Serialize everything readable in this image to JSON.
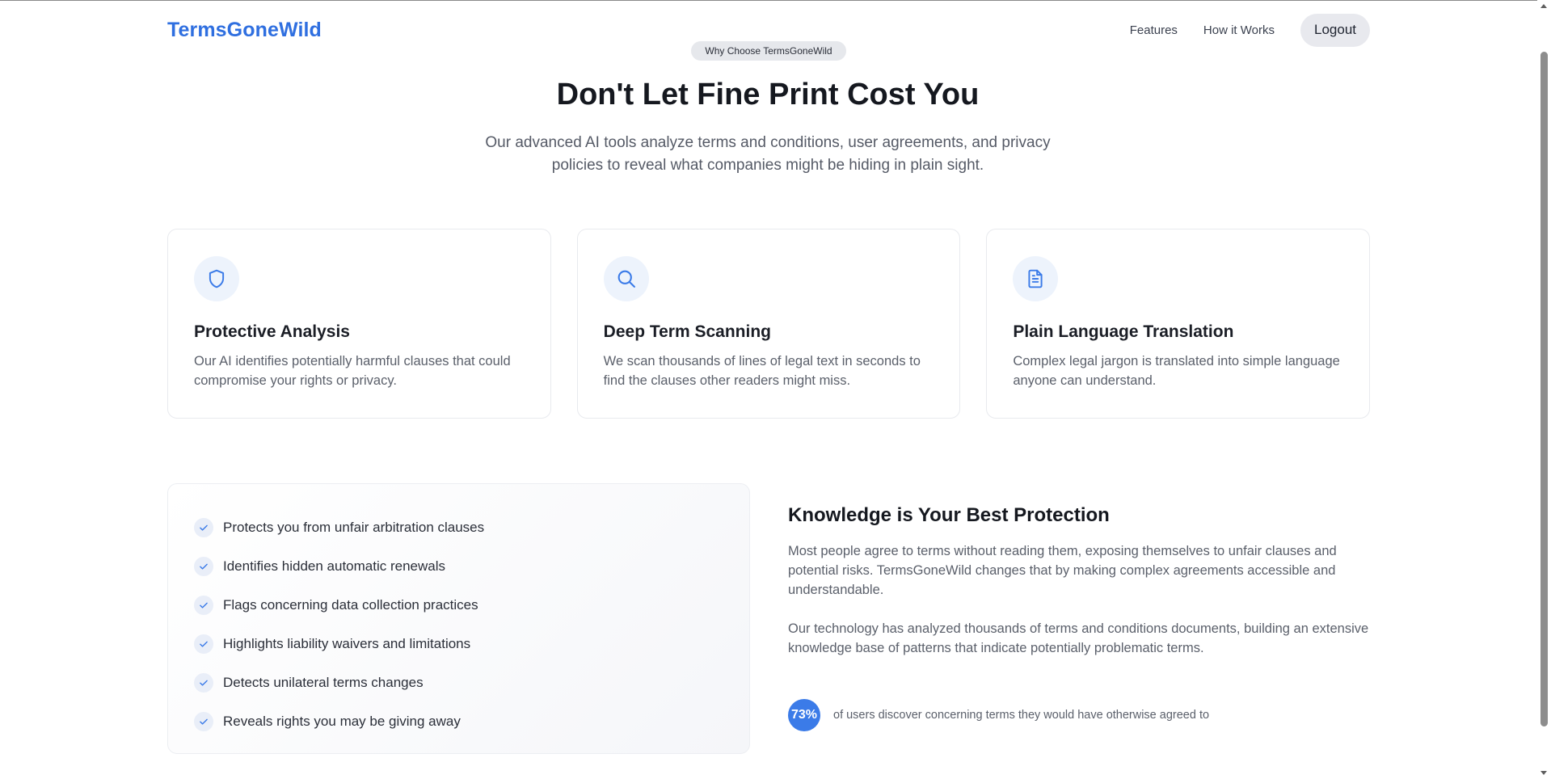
{
  "header": {
    "logo": "TermsGoneWild",
    "nav": [
      "Features",
      "How it Works"
    ],
    "logout_label": "Logout"
  },
  "hero": {
    "badge": "Why Choose TermsGoneWild",
    "title": "Don't Let Fine Print Cost You",
    "subtitle": "Our advanced AI tools analyze terms and conditions, user agreements, and privacy policies to reveal what companies might be hiding in plain sight."
  },
  "features": [
    {
      "icon": "shield-icon",
      "title": "Protective Analysis",
      "desc": "Our AI identifies potentially harmful clauses that could compromise your rights or privacy."
    },
    {
      "icon": "search-icon",
      "title": "Deep Term Scanning",
      "desc": "We scan thousands of lines of legal text in seconds to find the clauses other readers might miss."
    },
    {
      "icon": "document-icon",
      "title": "Plain Language Translation",
      "desc": "Complex legal jargon is translated into simple language anyone can understand."
    }
  ],
  "checklist": [
    "Protects you from unfair arbitration clauses",
    "Identifies hidden automatic renewals",
    "Flags concerning data collection practices",
    "Highlights liability waivers and limitations",
    "Detects unilateral terms changes",
    "Reveals rights you may be giving away"
  ],
  "knowledge": {
    "title": "Knowledge is Your Best Protection",
    "para1": "Most people agree to terms without reading them, exposing themselves to unfair clauses and potential risks. TermsGoneWild changes that by making complex agreements accessible and understandable.",
    "para2": "Our technology has analyzed thousands of terms and conditions documents, building an extensive knowledge base of patterns that indicate potentially problematic terms.",
    "stat_value": "73%",
    "stat_text": "of users discover concerning terms they would have otherwise agreed to"
  },
  "colors": {
    "accent": "#2f6fe0",
    "stat_circle": "#3b7be8"
  }
}
